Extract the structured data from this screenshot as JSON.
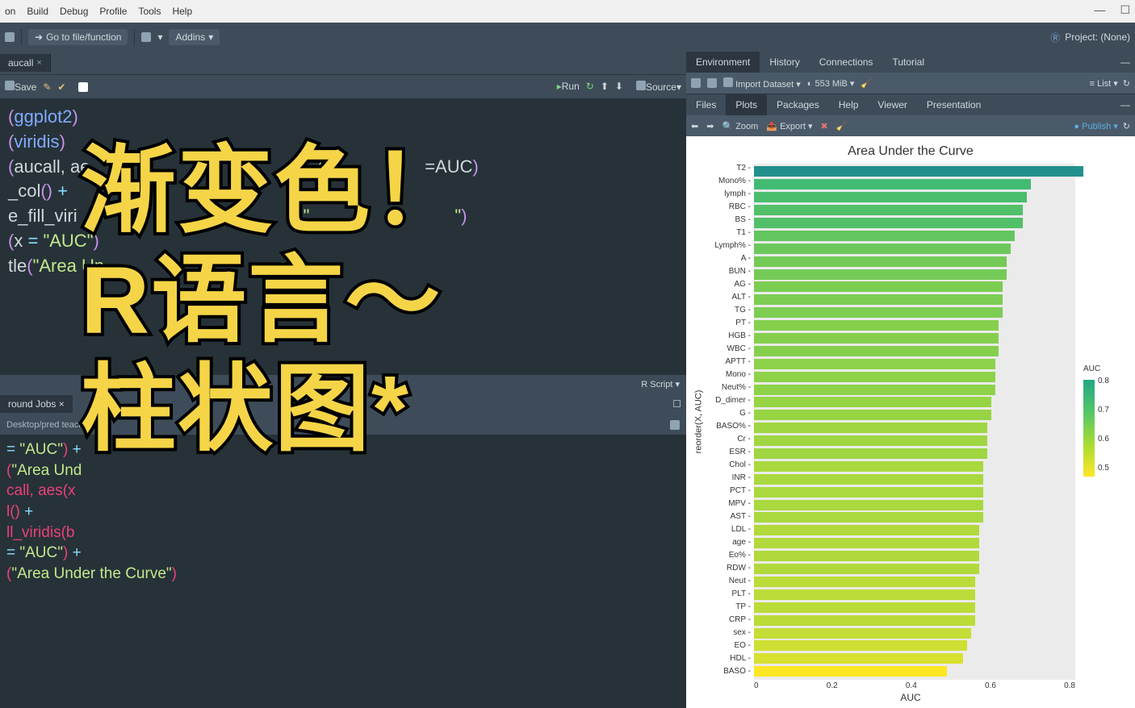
{
  "menubar": [
    "on",
    "Build",
    "Debug",
    "Profile",
    "Tools",
    "Help"
  ],
  "toolbar": {
    "goto_placeholder": "Go to file/function",
    "addins": "Addins",
    "project": "Project: (None)"
  },
  "editor": {
    "tab": "aucall",
    "save": "Save",
    "run": "Run",
    "source": "Source",
    "code_lines": [
      {
        "pre": "",
        "fn": "",
        "pkg": "(ggplot2)",
        "tail": ""
      },
      {
        "pre": "",
        "fn": "",
        "pkg": "(viridis)",
        "tail": ""
      },
      {
        "pre": "(aucall, ae",
        "tail2": "=AUC)"
      },
      {
        "pre": "_col() +"
      },
      {
        "pre": "e_fill_viri",
        "tail2": "\")"
      },
      {
        "pre": "(x = \"AUC\")"
      },
      {
        "pre": "tle(\"Area Un",
        "tail2": "ve"
      }
    ],
    "script_type": "R Script"
  },
  "console": {
    "tab": "round Jobs",
    "path": "Desktop/pred teach/",
    "lines": [
      "= \"AUC\") +",
      "(\"Area Und",
      "call, aes(x",
      "l() +",
      "ll_viridis(b",
      "= \"AUC\") +",
      "(\"Area Under the Curve\")"
    ]
  },
  "env_tabs": [
    "Environment",
    "History",
    "Connections",
    "Tutorial"
  ],
  "env_toolbar": {
    "import": "Import Dataset",
    "mem": "553 MiB",
    "list": "List"
  },
  "plot_tabs": [
    "Files",
    "Plots",
    "Packages",
    "Help",
    "Viewer",
    "Presentation"
  ],
  "plot_toolbar": {
    "zoom": "Zoom",
    "export": "Export",
    "publish": "Publish"
  },
  "overlay": {
    "l1": "渐变色！",
    "l2": "R语言〜",
    "l3": "柱状图*"
  },
  "chart_data": {
    "type": "bar",
    "orientation": "horizontal",
    "title": "Area Under the Curve",
    "xlabel": "AUC",
    "ylabel": "reorder(X, AUC)",
    "xlim": [
      0.0,
      0.8
    ],
    "xticks": [
      0.0,
      0.2,
      0.4,
      0.6,
      0.8
    ],
    "legend": {
      "title": "AUC",
      "ticks": [
        0.8,
        0.7,
        0.6,
        0.5
      ]
    },
    "categories": [
      "T2",
      "Mono%",
      "lymph",
      "RBC",
      "BS",
      "T1",
      "Lymph%",
      "A",
      "BUN",
      "AG",
      "ALT",
      "TG",
      "PT",
      "HGB",
      "WBC",
      "APTT",
      "Mono",
      "Neut%",
      "D_dimer",
      "G",
      "BASO%",
      "Cr",
      "ESR",
      "Chol",
      "INR",
      "PCT",
      "MPV",
      "AST",
      "LDL",
      "age",
      "Eo%",
      "RDW",
      "Neut",
      "PLT",
      "TP",
      "CRP",
      "sex",
      "EO",
      "HDL",
      "BASO"
    ],
    "values": [
      0.82,
      0.69,
      0.68,
      0.67,
      0.67,
      0.65,
      0.64,
      0.63,
      0.63,
      0.62,
      0.62,
      0.62,
      0.61,
      0.61,
      0.61,
      0.6,
      0.6,
      0.6,
      0.59,
      0.59,
      0.58,
      0.58,
      0.58,
      0.57,
      0.57,
      0.57,
      0.57,
      0.57,
      0.56,
      0.56,
      0.56,
      0.56,
      0.55,
      0.55,
      0.55,
      0.55,
      0.54,
      0.53,
      0.52,
      0.48
    ],
    "fill_scale": "viridis"
  }
}
